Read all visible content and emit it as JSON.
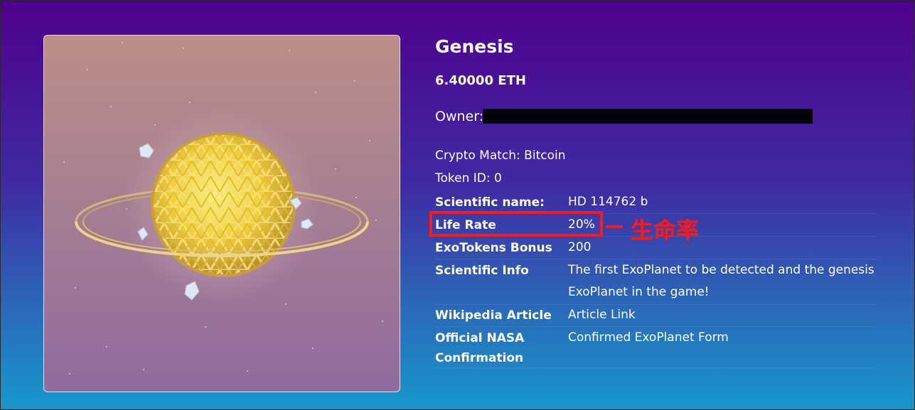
{
  "nft": {
    "title": "Genesis",
    "price": "6.40000 ETH",
    "owner_label": "Owner:",
    "crypto_match": "Crypto Match: Bitcoin",
    "token_id": "Token ID: 0"
  },
  "details": [
    {
      "label": "Scientific name:",
      "value": "HD 114762 b"
    },
    {
      "label": "Life Rate",
      "value": "20%"
    },
    {
      "label": "ExoTokens Bonus",
      "value": "200"
    },
    {
      "label": "Scientific Info",
      "value": "The first ExoPlanet to be detected and the genesis ExoPlanet in the game!"
    },
    {
      "label": "Wikipedia Article",
      "value": "Article Link"
    },
    {
      "label": "Official NASA Confirmation",
      "value": "Confirmed ExoPlanet Form"
    }
  ],
  "annotation": {
    "note": "生命率",
    "color": "#ff1a1a"
  },
  "colors": {
    "background_top": "#4f008e",
    "background_bottom": "#1798cc",
    "planet_gold": "#e8c35a",
    "planet_core": "#f7df3a"
  }
}
